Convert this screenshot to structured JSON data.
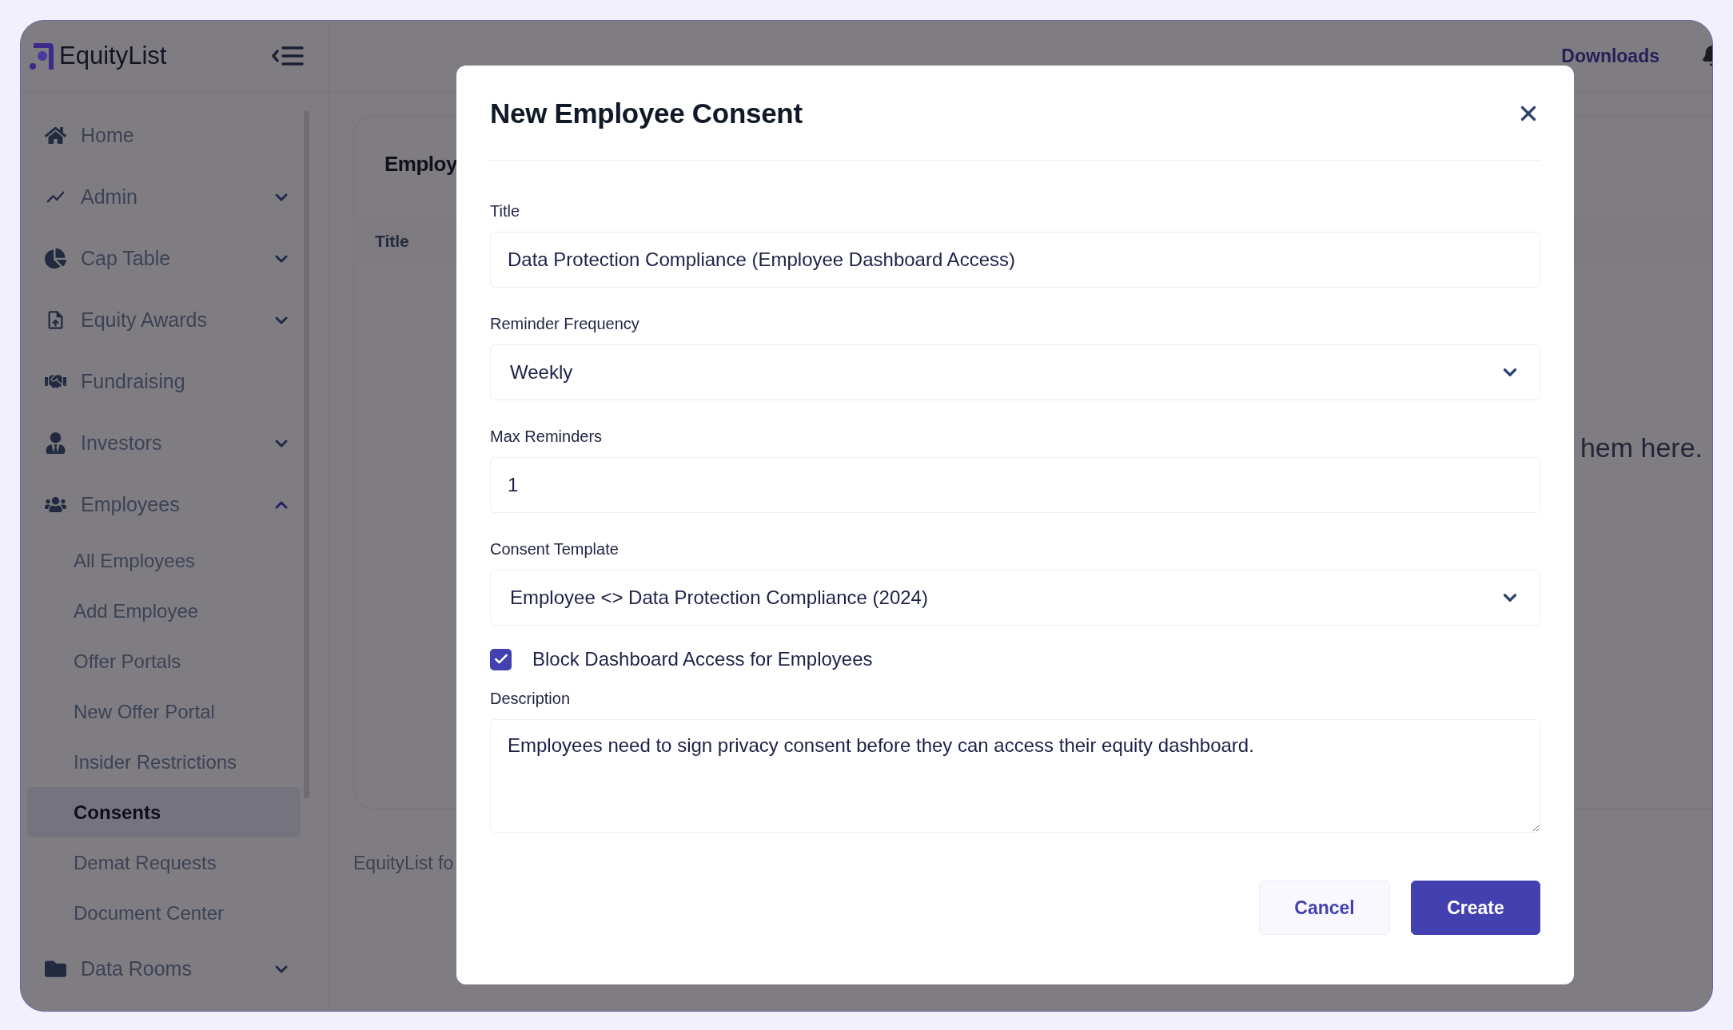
{
  "app": {
    "logo": "EquityList"
  },
  "sidebar": {
    "items": [
      {
        "label": "Home",
        "kind": "link"
      },
      {
        "label": "Admin",
        "kind": "group",
        "expanded": false
      },
      {
        "label": "Cap Table",
        "kind": "group",
        "expanded": false
      },
      {
        "label": "Equity Awards",
        "kind": "group",
        "expanded": false
      },
      {
        "label": "Fundraising",
        "kind": "link"
      },
      {
        "label": "Investors",
        "kind": "group",
        "expanded": false
      },
      {
        "label": "Employees",
        "kind": "group",
        "expanded": true,
        "children": [
          {
            "label": "All Employees",
            "selected": false
          },
          {
            "label": "Add Employee",
            "selected": false
          },
          {
            "label": "Offer Portals",
            "selected": false
          },
          {
            "label": "New Offer Portal",
            "selected": false
          },
          {
            "label": "Insider Restrictions",
            "selected": false
          },
          {
            "label": "Consents",
            "selected": true
          },
          {
            "label": "Demat Requests",
            "selected": false
          },
          {
            "label": "Document Center",
            "selected": false
          }
        ]
      },
      {
        "label": "Data Rooms",
        "kind": "group",
        "expanded": false
      }
    ]
  },
  "topbar": {
    "downloads": "Downloads"
  },
  "page": {
    "card_title": "Employ",
    "column_1": "Title",
    "empty_message": "hem here.",
    "footer": "EquityList fo"
  },
  "modal": {
    "title": "New Employee Consent",
    "fields": [
      {
        "kind": "text",
        "label": "Title",
        "value": "Data Protection Compliance (Employee Dashboard Access)"
      },
      {
        "kind": "select",
        "label": "Reminder Frequency",
        "value": "Weekly"
      },
      {
        "kind": "text",
        "label": "Max Reminders",
        "value": "1"
      },
      {
        "kind": "select",
        "label": "Consent Template",
        "value": "Employee <> Data Protection Compliance (2024)"
      },
      {
        "kind": "checkbox",
        "label": "Block Dashboard Access for Employees",
        "checked": true
      },
      {
        "kind": "textarea",
        "label": "Description",
        "value": "Employees need to sign privacy consent before they can access their equity dashboard."
      }
    ],
    "buttons": [
      {
        "label": "Cancel",
        "kind": "secondary"
      },
      {
        "label": "Create",
        "kind": "primary"
      }
    ]
  }
}
